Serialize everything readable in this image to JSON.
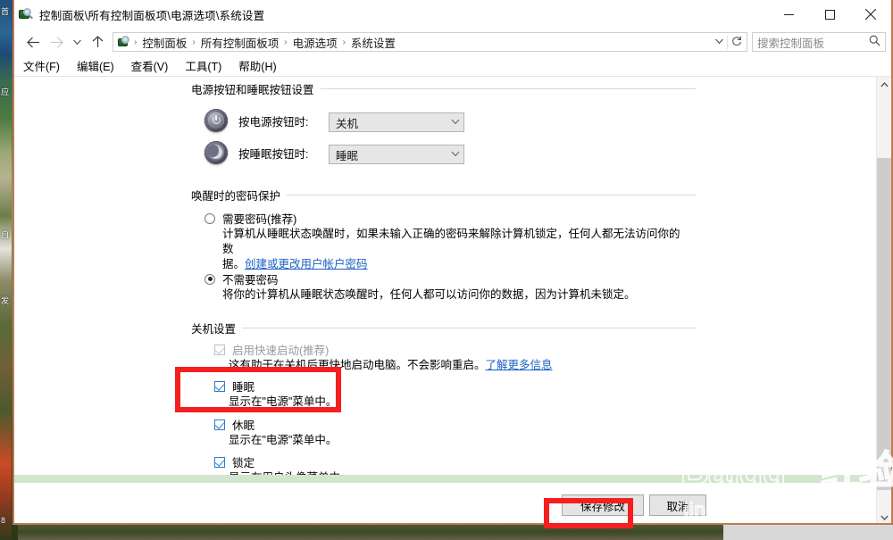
{
  "window": {
    "title": "控制面板\\所有控制面板项\\电源选项\\系统设置",
    "icon": "control-panel-icon",
    "minimize_label": "最小化",
    "maximize_label": "最大化",
    "close_label": "关闭"
  },
  "nav": {
    "back_label": "后退",
    "forward_label": "前进",
    "recent_label": "最近浏览的位置",
    "up_label": "上移一级",
    "breadcrumbs": [
      "控制面板",
      "所有控制面板项",
      "电源选项",
      "系统设置"
    ],
    "separator": "›",
    "dropdown_label": "历史记录",
    "refresh_label": "刷新"
  },
  "search": {
    "placeholder": "搜索控制面板",
    "icon": "search-icon"
  },
  "menu": [
    {
      "label": "文件(F)",
      "key": "F"
    },
    {
      "label": "编辑(E)",
      "key": "E"
    },
    {
      "label": "查看(V)",
      "key": "V"
    },
    {
      "label": "工具(T)",
      "key": "T"
    },
    {
      "label": "帮助(H)",
      "key": "H"
    }
  ],
  "groups": {
    "power_buttons": {
      "header": "电源按钮和睡眠按钮设置",
      "rows": [
        {
          "icon": "power-button-icon",
          "label": "按电源按钮时:",
          "value": "关机"
        },
        {
          "icon": "sleep-button-icon",
          "label": "按睡眠按钮时:",
          "value": "睡眠"
        }
      ]
    },
    "password_protection": {
      "header": "唤醒时的密码保护",
      "options": [
        {
          "label": "需要密码(推荐)",
          "checked": false,
          "desc_line1": "计算机从睡眠状态唤醒时，如果未输入正确的密码来解除计算机锁定，任何人都无法访问你的数",
          "desc_line2_prefix": "据。",
          "desc_link": "创建或更改用户帐户密码"
        },
        {
          "label": "不需要密码",
          "checked": true,
          "desc_line1": "将你的计算机从睡眠状态唤醒时，任何人都可以访问你的数据，因为计算机未锁定。"
        }
      ]
    },
    "shutdown_settings": {
      "header": "关机设置",
      "items": [
        {
          "label": "启用快速启动(推荐)",
          "checked": true,
          "disabled": true,
          "desc": "这有助于在关机后更快地启动电脑。不会影响重启。",
          "desc_link": "了解更多信息"
        },
        {
          "label": "睡眠",
          "checked": true,
          "disabled": false,
          "desc": "显示在\"电源\"菜单中。"
        },
        {
          "label": "休眠",
          "checked": true,
          "disabled": false,
          "desc": "显示在\"电源\"菜单中。"
        },
        {
          "label": "锁定",
          "checked": true,
          "disabled": false,
          "desc": "显示在用户头像菜单中。"
        }
      ]
    }
  },
  "actions": {
    "save_label": "保存修改",
    "cancel_label": "取消"
  },
  "annotations": {
    "highlight_color": "#f51f1f",
    "boxes": [
      "sleep-checkbox-highlight",
      "save-button-highlight"
    ]
  },
  "watermark": {
    "logo": "Baidu",
    "logo_cn": "经验",
    "url": "jingyan.baidu.com"
  },
  "scrollbar": {
    "up_arrow": "⌃",
    "down_arrow": "⌄"
  }
}
